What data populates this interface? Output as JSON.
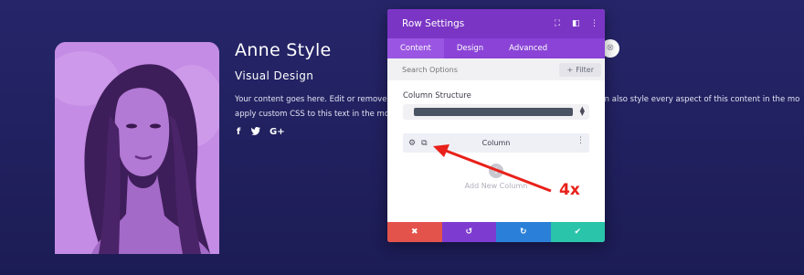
{
  "profile": {
    "name": "Anne Style",
    "role": "Visual Design",
    "body_lines": [
      "Your content goes here. Edit or remove",
      "apply custom CSS to this text in the mo"
    ],
    "body_tail": "an also style every aspect of this content in the mo",
    "socials": [
      {
        "icon": "facebook-icon",
        "glyph": "f"
      },
      {
        "icon": "twitter-icon",
        "glyph": "✓"
      },
      {
        "icon": "google-plus-icon",
        "glyph": "G+"
      }
    ]
  },
  "modal": {
    "title": "Row Settings",
    "header_icons": [
      "expand-icon",
      "sidebar-icon",
      "more-icon"
    ],
    "tabs": [
      {
        "label": "Content",
        "active": true
      },
      {
        "label": "Design",
        "active": false
      },
      {
        "label": "Advanced",
        "active": false
      }
    ],
    "search_placeholder": "Search Options",
    "filter_label": "Filter",
    "section_label": "Column Structure",
    "column_label": "Column",
    "add_column_label": "Add New Column",
    "footer_buttons": [
      {
        "name": "discard-button",
        "glyph": "✖",
        "color": "#e4534b"
      },
      {
        "name": "undo-button",
        "glyph": "↺",
        "color": "#7e3bd0"
      },
      {
        "name": "redo-button",
        "glyph": "↻",
        "color": "#2a80d8"
      },
      {
        "name": "save-button",
        "glyph": "✔",
        "color": "#29c4a9"
      }
    ]
  },
  "annotation": {
    "label": "4x",
    "color": "#e8211a"
  },
  "colors": {
    "background": "#1f1f5c",
    "modal_header": "#7b35c4",
    "tabs": "#8a43d6",
    "photo_tint": "#b477da"
  }
}
